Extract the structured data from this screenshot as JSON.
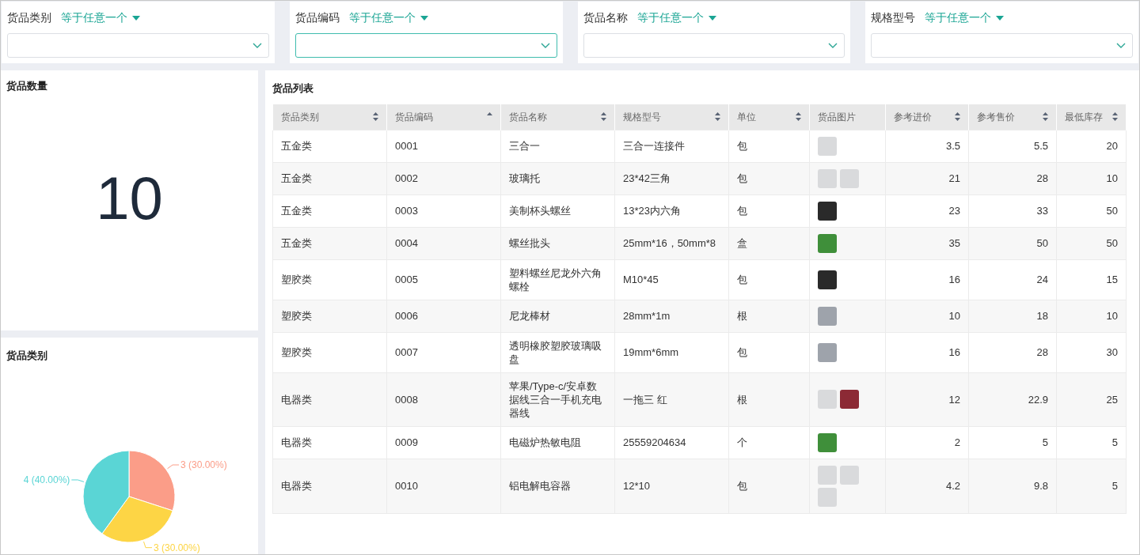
{
  "filters": [
    {
      "label": "货品类别",
      "operator": "等于任意一个",
      "focused": false
    },
    {
      "label": "货品编码",
      "operator": "等于任意一个",
      "focused": true
    },
    {
      "label": "货品名称",
      "operator": "等于任意一个",
      "focused": false
    },
    {
      "label": "规格型号",
      "operator": "等于任意一个",
      "focused": false
    }
  ],
  "count_card": {
    "title": "货品数量",
    "value": "10"
  },
  "pie_card": {
    "title": "货品类别",
    "chart_data": {
      "type": "pie",
      "values": [
        3,
        3,
        4
      ],
      "colors": [
        "#fb9d88",
        "#fdd545",
        "#5ad5d5"
      ],
      "value_labels": [
        "3 (30.00%)",
        "3 (30.00%)",
        "4 (40.00%)"
      ]
    }
  },
  "table": {
    "title": "货品列表",
    "columns": [
      {
        "label": "货品类别",
        "sortable": true,
        "sorted_ascending": false,
        "numeric": false
      },
      {
        "label": "货品编码",
        "sortable": true,
        "sorted_ascending": true,
        "numeric": false
      },
      {
        "label": "货品名称",
        "sortable": true,
        "sorted_ascending": false,
        "numeric": false
      },
      {
        "label": "规格型号",
        "sortable": true,
        "sorted_ascending": false,
        "numeric": false
      },
      {
        "label": "单位",
        "sortable": true,
        "sorted_ascending": false,
        "numeric": false
      },
      {
        "label": "货品图片",
        "sortable": false
      },
      {
        "label": "参考进价",
        "sortable": true,
        "sorted_ascending": false,
        "numeric": true
      },
      {
        "label": "参考售价",
        "sortable": true,
        "sorted_ascending": false,
        "numeric": true
      },
      {
        "label": "最低库存",
        "sortable": true,
        "sorted_ascending": false,
        "numeric": true
      }
    ],
    "rows": [
      {
        "cells": [
          "五金类",
          "0001",
          "三合一",
          "三合一连接件",
          "包",
          null,
          "3.5",
          "5.5",
          "20"
        ],
        "images": [
          {
            "kind": "light"
          }
        ]
      },
      {
        "cells": [
          "五金类",
          "0002",
          "玻璃托",
          "23*42三角",
          "包",
          null,
          "21",
          "28",
          "10"
        ],
        "images": [
          {
            "kind": "light"
          },
          {
            "kind": "light"
          }
        ]
      },
      {
        "cells": [
          "五金类",
          "0003",
          "美制杯头螺丝",
          "13*23内六角",
          "包",
          null,
          "23",
          "33",
          "50"
        ],
        "images": [
          {
            "kind": "dark"
          }
        ]
      },
      {
        "cells": [
          "五金类",
          "0004",
          "螺丝批头",
          "25mm*16，50mm*8",
          "盒",
          null,
          "35",
          "50",
          "50"
        ],
        "images": [
          {
            "kind": "green"
          }
        ]
      },
      {
        "cells": [
          "塑胶类",
          "0005",
          "塑料螺丝尼龙外六角螺栓",
          "M10*45",
          "包",
          null,
          "16",
          "24",
          "15"
        ],
        "images": [
          {
            "kind": "dark"
          }
        ]
      },
      {
        "cells": [
          "塑胶类",
          "0006",
          "尼龙棒材",
          "28mm*1m",
          "根",
          null,
          "10",
          "18",
          "10"
        ],
        "images": [
          {
            "kind": "grey"
          }
        ]
      },
      {
        "cells": [
          "塑胶类",
          "0007",
          "透明橡胶塑胶玻璃吸盘",
          "19mm*6mm",
          "包",
          null,
          "16",
          "28",
          "30"
        ],
        "images": [
          {
            "kind": "grey"
          }
        ]
      },
      {
        "cells": [
          "电器类",
          "0008",
          "苹果/Type-c/安卓数据线三合一手机充电器线",
          "一拖三 红",
          "根",
          null,
          "12",
          "22.9",
          "25"
        ],
        "images": [
          {
            "kind": "light"
          },
          {
            "kind": "red"
          }
        ]
      },
      {
        "cells": [
          "电器类",
          "0009",
          "电磁炉热敏电阻",
          "25559204634",
          "个",
          null,
          "2",
          "5",
          "5"
        ],
        "images": [
          {
            "kind": "green"
          }
        ]
      },
      {
        "cells": [
          "电器类",
          "0010",
          "铝电解电容器",
          "12*10",
          "包",
          null,
          "4.2",
          "9.8",
          "5"
        ],
        "images": [
          {
            "kind": "light"
          },
          {
            "kind": "light"
          },
          {
            "kind": "light"
          }
        ]
      }
    ]
  }
}
